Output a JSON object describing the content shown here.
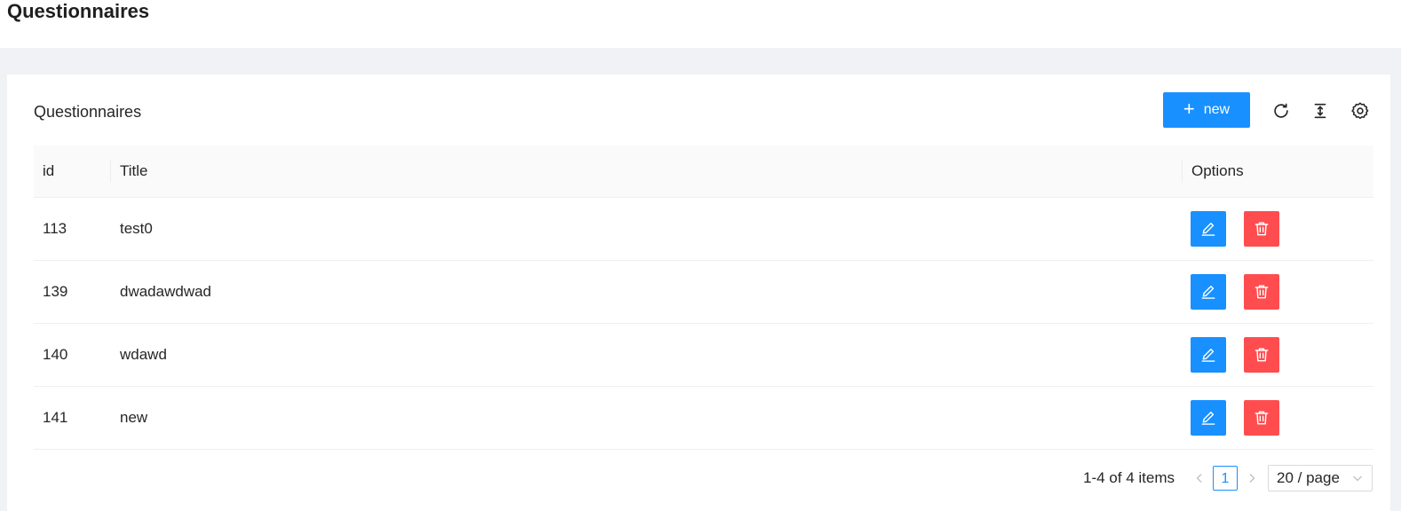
{
  "page": {
    "title": "Questionnaires"
  },
  "card": {
    "title": "Questionnaires",
    "new_button": {
      "icon": "plus-icon",
      "label": "new"
    },
    "tools": [
      "reload-icon",
      "column-height-icon",
      "setting-icon"
    ]
  },
  "table": {
    "columns": {
      "id": "id",
      "title": "Title",
      "options": "Options"
    },
    "rows": [
      {
        "id": "113",
        "title": "test0"
      },
      {
        "id": "139",
        "title": "dwadawdwad"
      },
      {
        "id": "140",
        "title": "wdawd"
      },
      {
        "id": "141",
        "title": "new"
      }
    ]
  },
  "pagination": {
    "total": "1-4 of 4 items",
    "prev": "<",
    "current_page": "1",
    "next": ">",
    "page_size": "20 / page"
  },
  "colors": {
    "primary": "#1890ff",
    "danger": "#ff4d4f",
    "band": "#f0f2f5",
    "header_bg": "#fafafa"
  }
}
